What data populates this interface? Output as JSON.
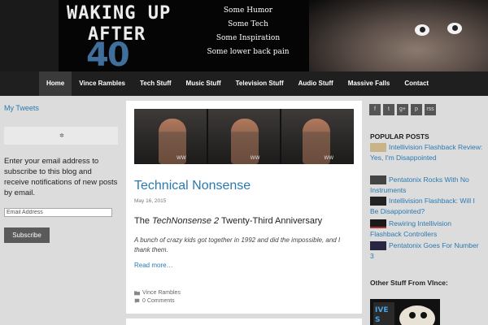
{
  "header": {
    "logo_line1": "WAKING UP",
    "logo_line2": "AFTER",
    "logo_number": "40",
    "taglines": [
      "Some Humor",
      "Some Tech",
      "Some Inspiration",
      "Some lower back pain"
    ]
  },
  "nav": {
    "items": [
      "Home",
      "Vince Rambles",
      "Tech Stuff",
      "Music Stuff",
      "Television Stuff",
      "Audio Stuff",
      "Massive Falls",
      "Contact"
    ],
    "active": "Home"
  },
  "left_sidebar": {
    "tweets_title": "My Tweets",
    "subscribe_text": "Enter your email address to subscribe to this blog and receive notifications of new posts by email.",
    "email_placeholder": "Email Address",
    "subscribe_label": "Subscribe"
  },
  "post": {
    "title": "Technical Nonsense",
    "date": "May 16, 2015",
    "heading_prefix": "The ",
    "heading_em": "TechNonsense 2",
    "heading_suffix": " Twenty-Third Anniversary",
    "excerpt": "A bunch of crazy kids got together in 1992 and did the impossible, and I thank them.",
    "read_more": "Read more…",
    "category": "Vince Rambles",
    "comments": "0 Comments",
    "watermark": "WW"
  },
  "right_sidebar": {
    "social_icons": [
      "f",
      "t",
      "g+",
      "p",
      "rss"
    ],
    "popular_title": "POPULAR POSTS",
    "popular_posts": [
      "Intellivision Flashback Review: Yes, I'm Disappointed",
      "Pentatonix Rocks With No Instruments",
      "Intellivision Flashback: Will I Be Disappointed?",
      "Rewiring Intellivision Flashback Controllers",
      "Pentatonix Goes For Number 3"
    ],
    "other_title": "Other Stuff From VInce:"
  },
  "colors": {
    "link": "#2a7ab0",
    "nav_bg": "#1f1f1f",
    "page_bg": "#dcdcdc"
  }
}
